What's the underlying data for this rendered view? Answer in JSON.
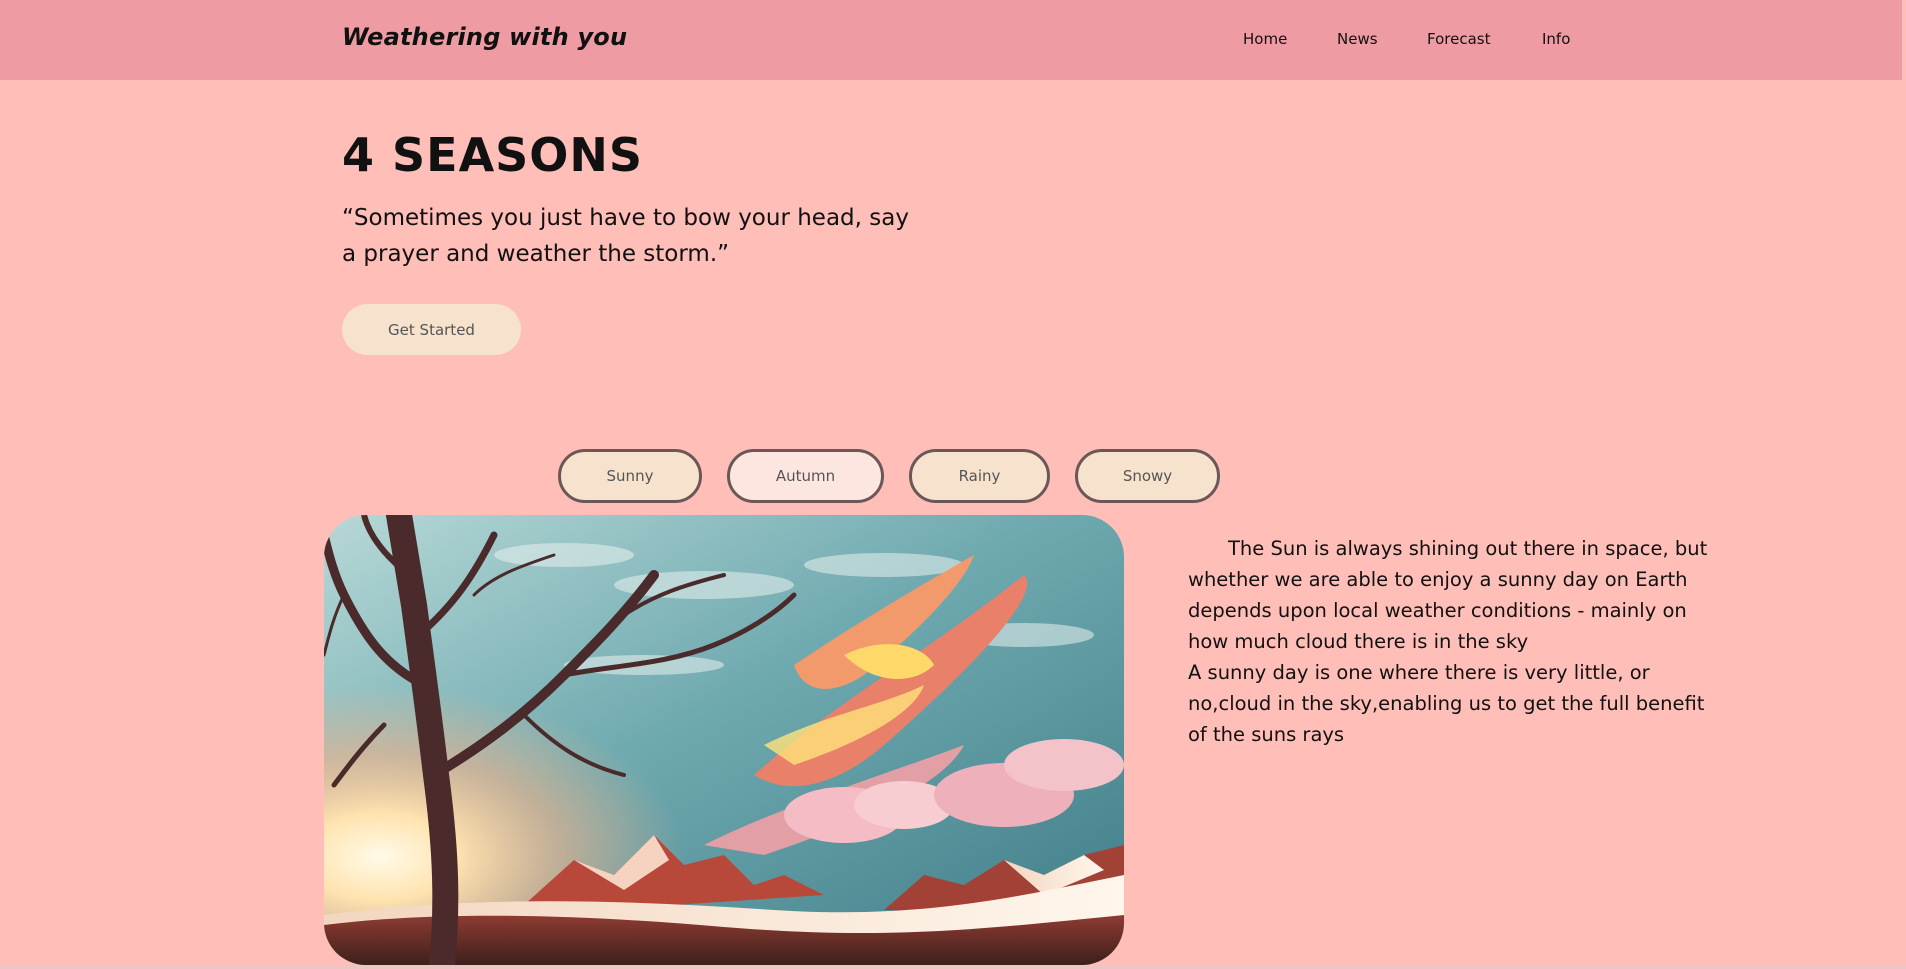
{
  "brand": "Weathering with you",
  "nav": {
    "home": "Home",
    "news": "News",
    "forecast": "Forecast",
    "info": "Info"
  },
  "hero": {
    "title": "4 SEASONS",
    "quote": "“Sometimes you just have to bow your head, say a prayer and weather the storm.”",
    "cta_label": "Get Started"
  },
  "seasons": {
    "tabs": [
      "Sunny",
      "Autumn",
      "Rainy",
      "Snowy"
    ],
    "active": "Autumn"
  },
  "content": {
    "line1": "The Sun is always shining out there in space, but whether we are able to enjoy a sunny day on Earth depends upon local weather conditions - mainly on how much cloud there is in the sky",
    "line2": "A sunny day is one where there is very little, or no,cloud in the sky,enabling us to get the full benefit of the suns rays"
  },
  "colors": {
    "background": "#ffbeb8",
    "navbar": "#ef9ba3",
    "button": "#f6e2cd",
    "button_border": "#6b5756"
  }
}
